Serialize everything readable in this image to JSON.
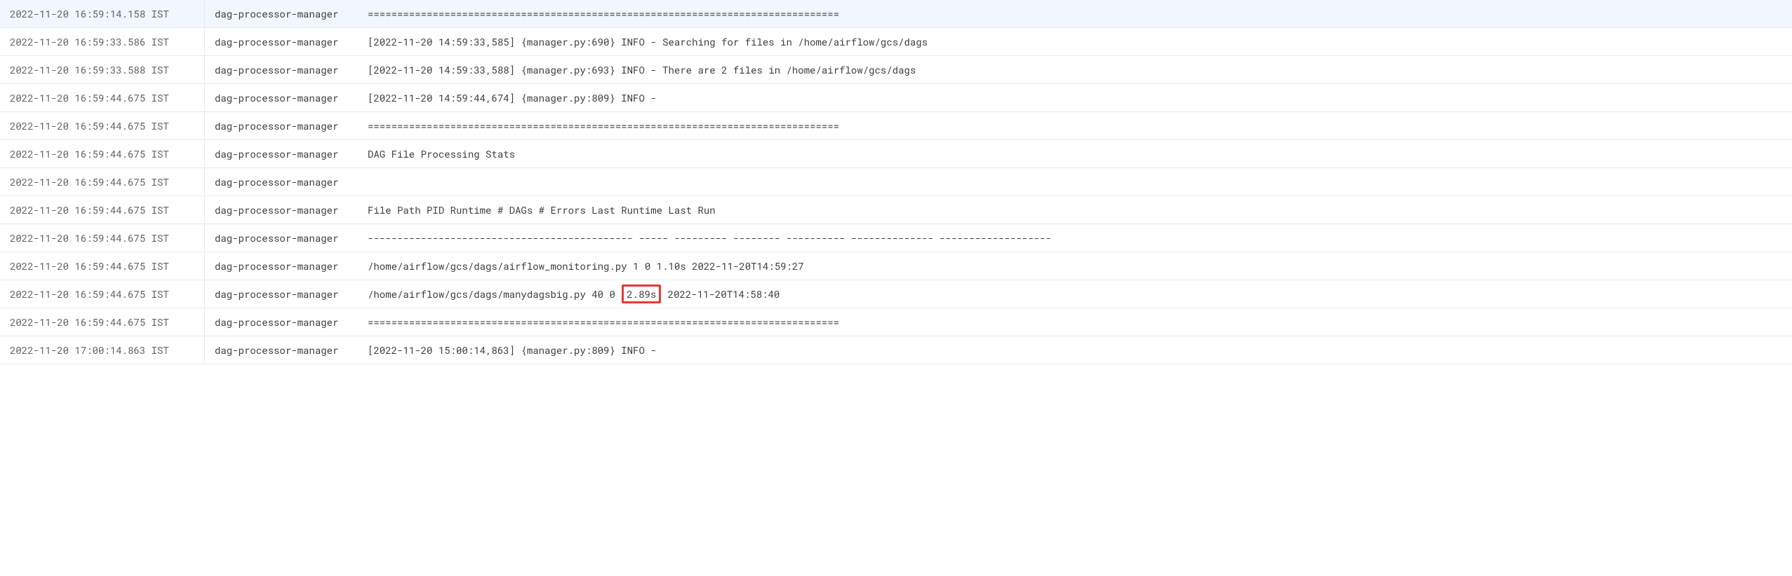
{
  "rows": [
    {
      "timestamp": "2022-11-20 16:59:14.158 IST",
      "source": "dag-processor-manager",
      "message": "================================================================================"
    },
    {
      "timestamp": "2022-11-20 16:59:33.586 IST",
      "source": "dag-processor-manager",
      "message": "[2022-11-20 14:59:33,585] {manager.py:690} INFO - Searching for files in /home/airflow/gcs/dags"
    },
    {
      "timestamp": "2022-11-20 16:59:33.588 IST",
      "source": "dag-processor-manager",
      "message": "[2022-11-20 14:59:33,588] {manager.py:693} INFO - There are 2 files in /home/airflow/gcs/dags"
    },
    {
      "timestamp": "2022-11-20 16:59:44.675 IST",
      "source": "dag-processor-manager",
      "message": "[2022-11-20 14:59:44,674] {manager.py:809} INFO -"
    },
    {
      "timestamp": "2022-11-20 16:59:44.675 IST",
      "source": "dag-processor-manager",
      "message": "================================================================================"
    },
    {
      "timestamp": "2022-11-20 16:59:44.675 IST",
      "source": "dag-processor-manager",
      "message": "DAG File Processing Stats"
    },
    {
      "timestamp": "2022-11-20 16:59:44.675 IST",
      "source": "dag-processor-manager",
      "message": ""
    },
    {
      "timestamp": "2022-11-20 16:59:44.675 IST",
      "source": "dag-processor-manager",
      "message": "File Path PID Runtime # DAGs # Errors Last Runtime Last Run"
    },
    {
      "timestamp": "2022-11-20 16:59:44.675 IST",
      "source": "dag-processor-manager",
      "message": "--------------------------------------------- ----- --------- -------- ---------- -------------- -------------------"
    },
    {
      "timestamp": "2022-11-20 16:59:44.675 IST",
      "source": "dag-processor-manager",
      "message": "/home/airflow/gcs/dags/airflow_monitoring.py 1 0 1.10s 2022-11-20T14:59:27"
    },
    {
      "timestamp": "2022-11-20 16:59:44.675 IST",
      "source": "dag-processor-manager",
      "message_before": "/home/airflow/gcs/dags/manydagsbig.py 40 0 ",
      "message_highlight": "2.89s",
      "message_after": " 2022-11-20T14:58:40",
      "has_highlight": true
    },
    {
      "timestamp": "2022-11-20 16:59:44.675 IST",
      "source": "dag-processor-manager",
      "message": "================================================================================"
    },
    {
      "timestamp": "2022-11-20 17:00:14.863 IST",
      "source": "dag-processor-manager",
      "message": "[2022-11-20 15:00:14,863] {manager.py:809} INFO -"
    }
  ]
}
